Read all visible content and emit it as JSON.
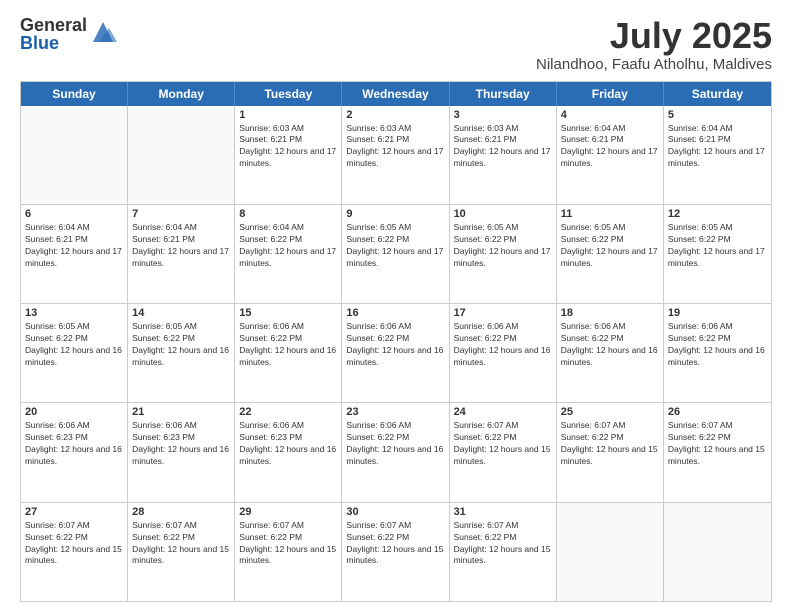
{
  "logo": {
    "general": "General",
    "blue": "Blue"
  },
  "header": {
    "title": "July 2025",
    "subtitle": "Nilandhoo, Faafu Atholhu, Maldives"
  },
  "days_of_week": [
    "Sunday",
    "Monday",
    "Tuesday",
    "Wednesday",
    "Thursday",
    "Friday",
    "Saturday"
  ],
  "weeks": [
    [
      {
        "day": "",
        "info": ""
      },
      {
        "day": "",
        "info": ""
      },
      {
        "day": "1",
        "info": "Sunrise: 6:03 AM\nSunset: 6:21 PM\nDaylight: 12 hours and 17 minutes."
      },
      {
        "day": "2",
        "info": "Sunrise: 6:03 AM\nSunset: 6:21 PM\nDaylight: 12 hours and 17 minutes."
      },
      {
        "day": "3",
        "info": "Sunrise: 6:03 AM\nSunset: 6:21 PM\nDaylight: 12 hours and 17 minutes."
      },
      {
        "day": "4",
        "info": "Sunrise: 6:04 AM\nSunset: 6:21 PM\nDaylight: 12 hours and 17 minutes."
      },
      {
        "day": "5",
        "info": "Sunrise: 6:04 AM\nSunset: 6:21 PM\nDaylight: 12 hours and 17 minutes."
      }
    ],
    [
      {
        "day": "6",
        "info": "Sunrise: 6:04 AM\nSunset: 6:21 PM\nDaylight: 12 hours and 17 minutes."
      },
      {
        "day": "7",
        "info": "Sunrise: 6:04 AM\nSunset: 6:21 PM\nDaylight: 12 hours and 17 minutes."
      },
      {
        "day": "8",
        "info": "Sunrise: 6:04 AM\nSunset: 6:22 PM\nDaylight: 12 hours and 17 minutes."
      },
      {
        "day": "9",
        "info": "Sunrise: 6:05 AM\nSunset: 6:22 PM\nDaylight: 12 hours and 17 minutes."
      },
      {
        "day": "10",
        "info": "Sunrise: 6:05 AM\nSunset: 6:22 PM\nDaylight: 12 hours and 17 minutes."
      },
      {
        "day": "11",
        "info": "Sunrise: 6:05 AM\nSunset: 6:22 PM\nDaylight: 12 hours and 17 minutes."
      },
      {
        "day": "12",
        "info": "Sunrise: 6:05 AM\nSunset: 6:22 PM\nDaylight: 12 hours and 17 minutes."
      }
    ],
    [
      {
        "day": "13",
        "info": "Sunrise: 6:05 AM\nSunset: 6:22 PM\nDaylight: 12 hours and 16 minutes."
      },
      {
        "day": "14",
        "info": "Sunrise: 6:05 AM\nSunset: 6:22 PM\nDaylight: 12 hours and 16 minutes."
      },
      {
        "day": "15",
        "info": "Sunrise: 6:06 AM\nSunset: 6:22 PM\nDaylight: 12 hours and 16 minutes."
      },
      {
        "day": "16",
        "info": "Sunrise: 6:06 AM\nSunset: 6:22 PM\nDaylight: 12 hours and 16 minutes."
      },
      {
        "day": "17",
        "info": "Sunrise: 6:06 AM\nSunset: 6:22 PM\nDaylight: 12 hours and 16 minutes."
      },
      {
        "day": "18",
        "info": "Sunrise: 6:06 AM\nSunset: 6:22 PM\nDaylight: 12 hours and 16 minutes."
      },
      {
        "day": "19",
        "info": "Sunrise: 6:06 AM\nSunset: 6:22 PM\nDaylight: 12 hours and 16 minutes."
      }
    ],
    [
      {
        "day": "20",
        "info": "Sunrise: 6:06 AM\nSunset: 6:23 PM\nDaylight: 12 hours and 16 minutes."
      },
      {
        "day": "21",
        "info": "Sunrise: 6:06 AM\nSunset: 6:23 PM\nDaylight: 12 hours and 16 minutes."
      },
      {
        "day": "22",
        "info": "Sunrise: 6:06 AM\nSunset: 6:23 PM\nDaylight: 12 hours and 16 minutes."
      },
      {
        "day": "23",
        "info": "Sunrise: 6:06 AM\nSunset: 6:22 PM\nDaylight: 12 hours and 16 minutes."
      },
      {
        "day": "24",
        "info": "Sunrise: 6:07 AM\nSunset: 6:22 PM\nDaylight: 12 hours and 15 minutes."
      },
      {
        "day": "25",
        "info": "Sunrise: 6:07 AM\nSunset: 6:22 PM\nDaylight: 12 hours and 15 minutes."
      },
      {
        "day": "26",
        "info": "Sunrise: 6:07 AM\nSunset: 6:22 PM\nDaylight: 12 hours and 15 minutes."
      }
    ],
    [
      {
        "day": "27",
        "info": "Sunrise: 6:07 AM\nSunset: 6:22 PM\nDaylight: 12 hours and 15 minutes."
      },
      {
        "day": "28",
        "info": "Sunrise: 6:07 AM\nSunset: 6:22 PM\nDaylight: 12 hours and 15 minutes."
      },
      {
        "day": "29",
        "info": "Sunrise: 6:07 AM\nSunset: 6:22 PM\nDaylight: 12 hours and 15 minutes."
      },
      {
        "day": "30",
        "info": "Sunrise: 6:07 AM\nSunset: 6:22 PM\nDaylight: 12 hours and 15 minutes."
      },
      {
        "day": "31",
        "info": "Sunrise: 6:07 AM\nSunset: 6:22 PM\nDaylight: 12 hours and 15 minutes."
      },
      {
        "day": "",
        "info": ""
      },
      {
        "day": "",
        "info": ""
      }
    ]
  ]
}
